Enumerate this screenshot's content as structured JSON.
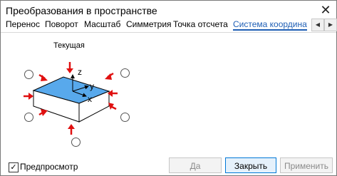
{
  "window": {
    "title": "Преобразования в пространстве",
    "close_glyph": "✕"
  },
  "tabs": [
    {
      "label": "Перенос"
    },
    {
      "label": "Поворот"
    },
    {
      "label": "Масштаб"
    },
    {
      "label": "Симметрия"
    },
    {
      "label": "Точка отсчета"
    },
    {
      "label": "Система координат"
    }
  ],
  "tab_scroll": {
    "left": "◀",
    "right": "▶"
  },
  "preview": {
    "caption": "Текущая",
    "axis_labels": {
      "z": "z",
      "y": "y",
      "x": "x"
    },
    "colors": {
      "top_face": "#58a9ec",
      "arrow": "#e01010"
    }
  },
  "footer": {
    "preview_checkbox": {
      "label": "Предпросмотр",
      "checked": true,
      "mark": "✓"
    },
    "buttons": {
      "yes": "Да",
      "close": "Закрыть",
      "apply": "Применить"
    }
  }
}
